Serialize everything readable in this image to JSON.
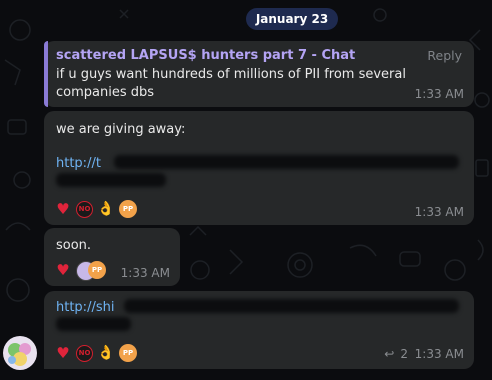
{
  "date_label": "January 23",
  "messages": [
    {
      "reply_title": "scattered LAPSUS$ hunters part 7 - Chat",
      "reply_action": "Reply",
      "text": "if u guys want hundreds of millions of PII from several companies dbs",
      "time": "1:33 AM"
    },
    {
      "text": "we are giving away:",
      "link_visible": "http://t",
      "time": "1:33 AM",
      "reactions": [
        "heart-icon",
        "no-entry-icon",
        "ok-hand-icon",
        "pp-badge-icon"
      ]
    },
    {
      "text": "soon.",
      "time": "1:33 AM",
      "reactions": [
        "heart-icon",
        "user-avatar-icon",
        "pp-badge-icon"
      ]
    },
    {
      "link_visible": "http://shi",
      "time": "1:33 AM",
      "reply_count": "2",
      "reactions": [
        "heart-icon",
        "no-entry-icon",
        "ok-hand-icon",
        "pp-badge-icon"
      ]
    }
  ],
  "colors": {
    "background": "#0b0c0f",
    "bubble": "#262829",
    "accent_purple": "#b4a4f4",
    "link": "#6fb3f3",
    "date_pill": "#1e2a4f"
  }
}
